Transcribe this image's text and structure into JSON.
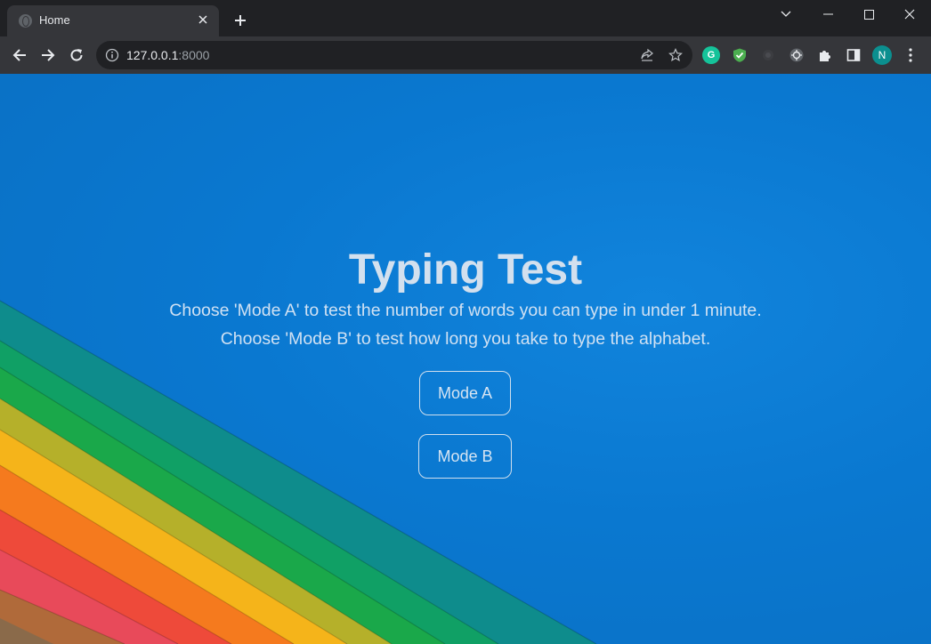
{
  "browser": {
    "tab_title": "Home",
    "url_host": "127.0.0.1",
    "url_port": ":8000",
    "profile_initial": "N",
    "grammarly_letter": "G"
  },
  "page": {
    "title": "Typing Test",
    "instruction_a": "Choose 'Mode A' to test the number of words you can type in under 1 minute.",
    "instruction_b": "Choose 'Mode B' to test how long you take to type the alphabet.",
    "mode_a_label": "Mode A",
    "mode_b_label": "Mode B"
  },
  "colors": {
    "background_blue": "#0a78d0",
    "stripe_teal": "#0e8c8c",
    "stripe_green": "#1aa84a",
    "stripe_olive": "#b5b02a",
    "stripe_yellow": "#f5b41a",
    "stripe_orange": "#f57a1e",
    "stripe_red": "#ee4a3a",
    "stripe_pink": "#e84a5a",
    "stripe_brown": "#9a6a3a"
  },
  "icons": [
    "back-arrow-icon",
    "forward-arrow-icon",
    "reload-icon",
    "info-icon",
    "share-icon",
    "star-icon",
    "grammarly-icon",
    "shield-extension-icon",
    "extension-icon",
    "extensions-puzzle-icon",
    "side-panel-icon",
    "kebab-menu-icon"
  ]
}
